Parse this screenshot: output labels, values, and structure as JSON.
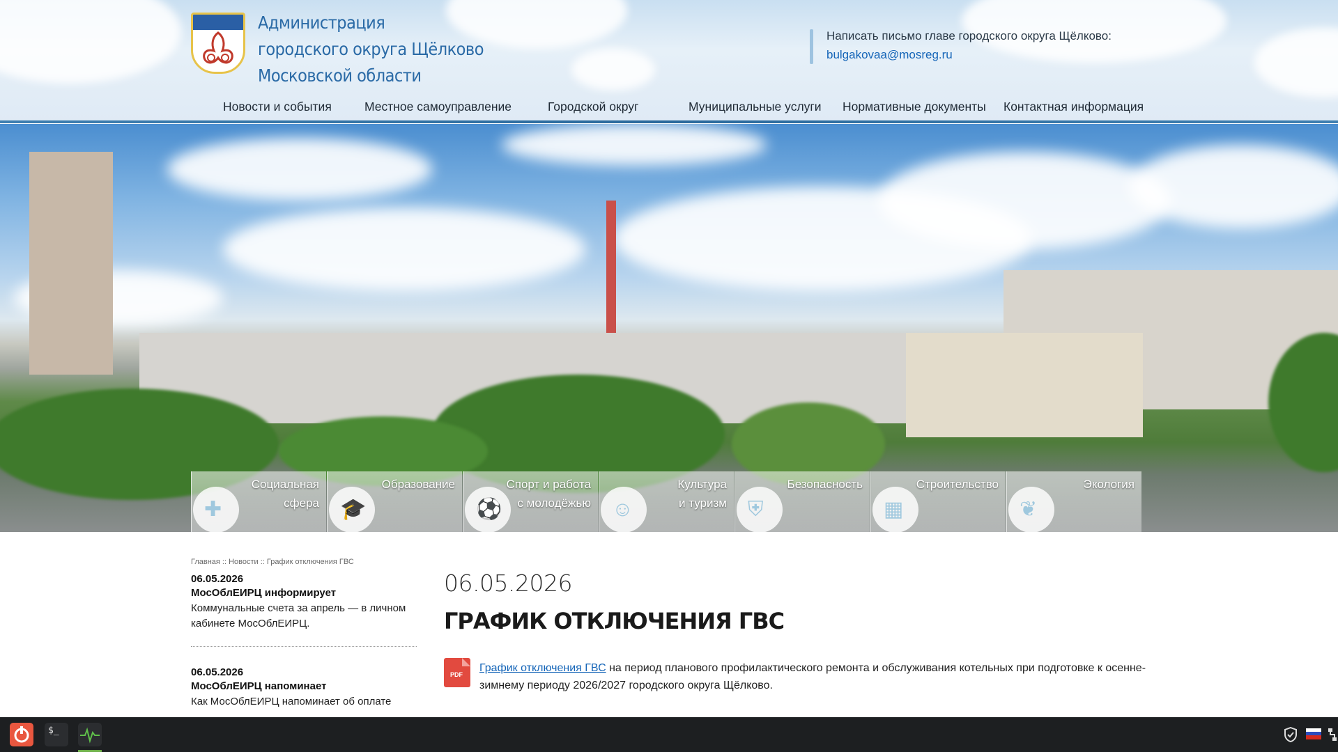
{
  "header": {
    "org_title": [
      "Администрация",
      "городского округа Щёлково",
      "Московской области"
    ],
    "contact_text": "Написать письмо главе городского округа Щёлково:",
    "contact_email": "bulgakovaa@mosreg.ru"
  },
  "nav": {
    "items": [
      "Новости и события",
      "Местное самоуправление",
      "Городской округ",
      "Муниципальные услуги",
      "Нормативные документы",
      "Контактная информация"
    ]
  },
  "categories": [
    {
      "line1": "Социальная",
      "line2": "сфера",
      "icon": "medkit-icon"
    },
    {
      "line1": "Образование",
      "line2": "",
      "icon": "graduation-cap-icon"
    },
    {
      "line1": "Спорт и работа",
      "line2": "с молодёжью",
      "icon": "soccer-ball-icon"
    },
    {
      "line1": "Культура",
      "line2": "и туризм",
      "icon": "theater-masks-icon"
    },
    {
      "line1": "Безопасность",
      "line2": "",
      "icon": "shield-icon"
    },
    {
      "line1": "Строительство",
      "line2": "",
      "icon": "building-icon"
    },
    {
      "line1": "Экология",
      "line2": "",
      "icon": "leaf-hand-icon"
    }
  ],
  "breadcrumb": "Главная :: Новости :: График отключения ГВС",
  "sidebar_news": [
    {
      "date": "06.05.2026",
      "title": "МосОблЕИРЦ информирует",
      "text": "Коммунальные счета за апрель — в личном кабинете МосОблЕИРЦ."
    },
    {
      "date": "06.05.2026",
      "title": "МосОблЕИРЦ напоминает",
      "text": "Как МосОблЕИРЦ напоминает об оплате"
    }
  ],
  "article": {
    "date": "06.05.2026",
    "title": "ГРАФИК ОТКЛЮЧЕНИЯ ГВС",
    "pdf_label": "PDF",
    "link_text": "График отключения ГВС",
    "body": " на период планового профилактического ремонта и обслуживания котельных при подготовке к осенне-зимнему периоду 2026/2027 городского округа Щёлково."
  },
  "taskbar": {
    "apps": [
      "power-app-icon",
      "terminal-icon",
      "system-monitor-icon"
    ],
    "terminal_label": "$_",
    "tray": [
      "shield-tray-icon",
      "russian-flag-icon",
      "network-icon"
    ]
  }
}
